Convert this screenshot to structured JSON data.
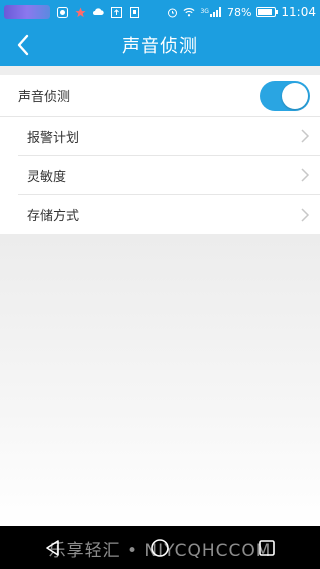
{
  "status_bar": {
    "battery": "78%",
    "time": "11:04",
    "network": "3G"
  },
  "header": {
    "title": "声音侦测"
  },
  "settings": {
    "toggle_row": {
      "label": "声音侦测",
      "enabled": true
    },
    "items": [
      {
        "label": "报警计划"
      },
      {
        "label": "灵敏度"
      },
      {
        "label": "存储方式"
      }
    ]
  },
  "watermark": "乐享轻汇 • NIYCQHCCOM",
  "colors": {
    "primary": "#1c9ee0",
    "toggle_on": "#2aa5e2",
    "divider": "#e6e6e6"
  }
}
